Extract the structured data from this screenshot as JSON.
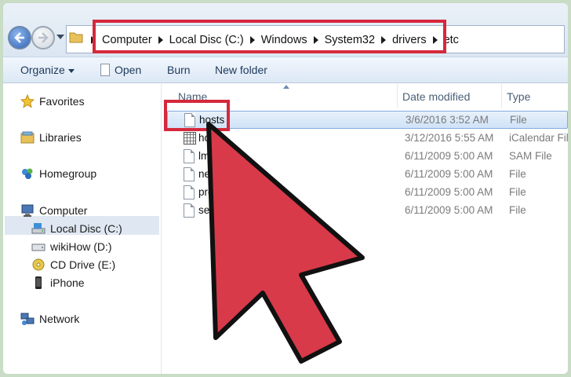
{
  "window": {
    "address_crumbs": [
      "Computer",
      "Local Disc (C:)",
      "Windows",
      "System32",
      "drivers",
      "etc"
    ]
  },
  "toolbar": {
    "organize_label": "Organize",
    "open_label": "Open",
    "burn_label": "Burn",
    "new_folder_label": "New folder"
  },
  "sidebar": {
    "favorites": "Favorites",
    "libraries": "Libraries",
    "homegroup": "Homegroup",
    "computer": "Computer",
    "drives": [
      {
        "label": "Local Disc (C:)",
        "icon": "hard-drive-icon",
        "selected": true
      },
      {
        "label": "wikiHow (D:)",
        "icon": "drive-icon",
        "selected": false
      },
      {
        "label": "CD Drive (E:)",
        "icon": "cd-drive-icon",
        "selected": false
      },
      {
        "label": "iPhone",
        "icon": "iphone-icon",
        "selected": false
      }
    ],
    "network": "Network"
  },
  "columns": {
    "name": "Name",
    "date_modified": "Date modified",
    "type": "Type"
  },
  "files": [
    {
      "name": "hosts",
      "date": "3/6/2016 3:52 AM",
      "type": "File",
      "icon": "file-icon",
      "selected": true
    },
    {
      "name": "hosts.ics",
      "visible_name": "ho    cs",
      "date": "3/12/2016 5:55 AM",
      "type": "iCalendar File",
      "icon": "calendar-icon"
    },
    {
      "name": "lmhosts.sam",
      "visible_name": "lm         m",
      "date": "6/11/2009 5:00 AM",
      "type": "SAM File",
      "icon": "file-icon"
    },
    {
      "name": "networks",
      "visible_name": "net",
      "date": "6/11/2009 5:00 AM",
      "type": "File",
      "icon": "file-icon"
    },
    {
      "name": "protocol",
      "visible_name": "pro",
      "date": "6/11/2009 5:00 AM",
      "type": "File",
      "icon": "file-icon"
    },
    {
      "name": "services",
      "visible_name": "ser",
      "date": "6/11/2009 5:00 AM",
      "type": "File",
      "icon": "file-icon"
    }
  ],
  "colors": {
    "highlight_red": "#d5283c",
    "arrow_red": "#d83a49"
  }
}
